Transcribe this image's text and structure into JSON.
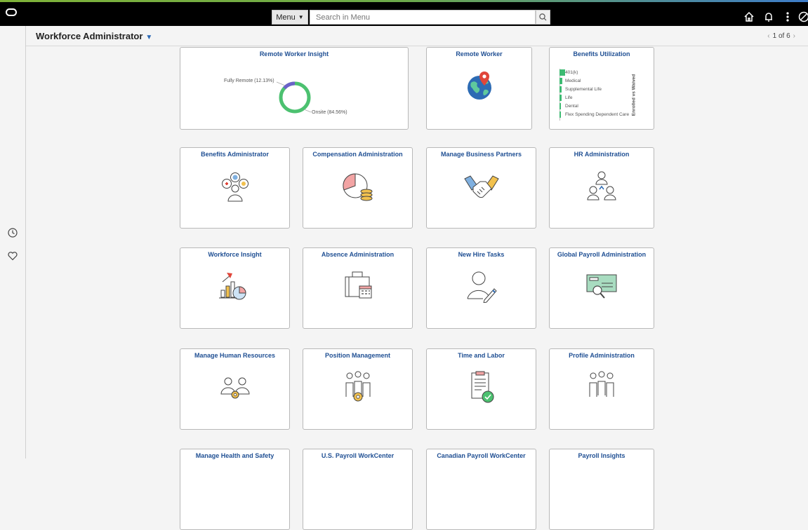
{
  "topbar": {
    "menu_label": "Menu",
    "search_placeholder": "Search in Menu"
  },
  "header": {
    "title": "Workforce Administrator",
    "pager": "1 of 6"
  },
  "tiles": {
    "remote_worker_insight": {
      "title": "Remote Worker Insight",
      "label_remote": "Fully Remote (12.13%)",
      "label_onsite": "Onsite (84.56%)"
    },
    "remote_worker": {
      "title": "Remote Worker"
    },
    "benefits_utilization": {
      "title": "Benefits Utilization",
      "axis_label": "Enrolled vs Waived",
      "items": [
        "401(k)",
        "Medical",
        "Supplemental Life",
        "Life",
        "Dental",
        "Flex Spending Dependent Care"
      ]
    },
    "benefits_administrator": {
      "title": "Benefits Administrator"
    },
    "compensation_administration": {
      "title": "Compensation Administration"
    },
    "manage_business_partners": {
      "title": "Manage Business Partners"
    },
    "hr_administration": {
      "title": "HR Administration"
    },
    "workforce_insight": {
      "title": "Workforce Insight"
    },
    "absence_administration": {
      "title": "Absence Administration"
    },
    "new_hire_tasks": {
      "title": "New Hire Tasks"
    },
    "global_payroll_administration": {
      "title": "Global Payroll Administration"
    },
    "manage_human_resources": {
      "title": "Manage Human Resources"
    },
    "position_management": {
      "title": "Position Management"
    },
    "time_and_labor": {
      "title": "Time and Labor"
    },
    "profile_administration": {
      "title": "Profile Administration"
    },
    "manage_health_and_safety": {
      "title": "Manage Health and Safety"
    },
    "us_payroll_workcenter": {
      "title": "U.S. Payroll WorkCenter"
    },
    "canadian_payroll_workcenter": {
      "title": "Canadian Payroll WorkCenter"
    },
    "payroll_insights": {
      "title": "Payroll Insights"
    }
  },
  "colors": {
    "accent": "#1f4f93",
    "green": "#3dbb72"
  }
}
